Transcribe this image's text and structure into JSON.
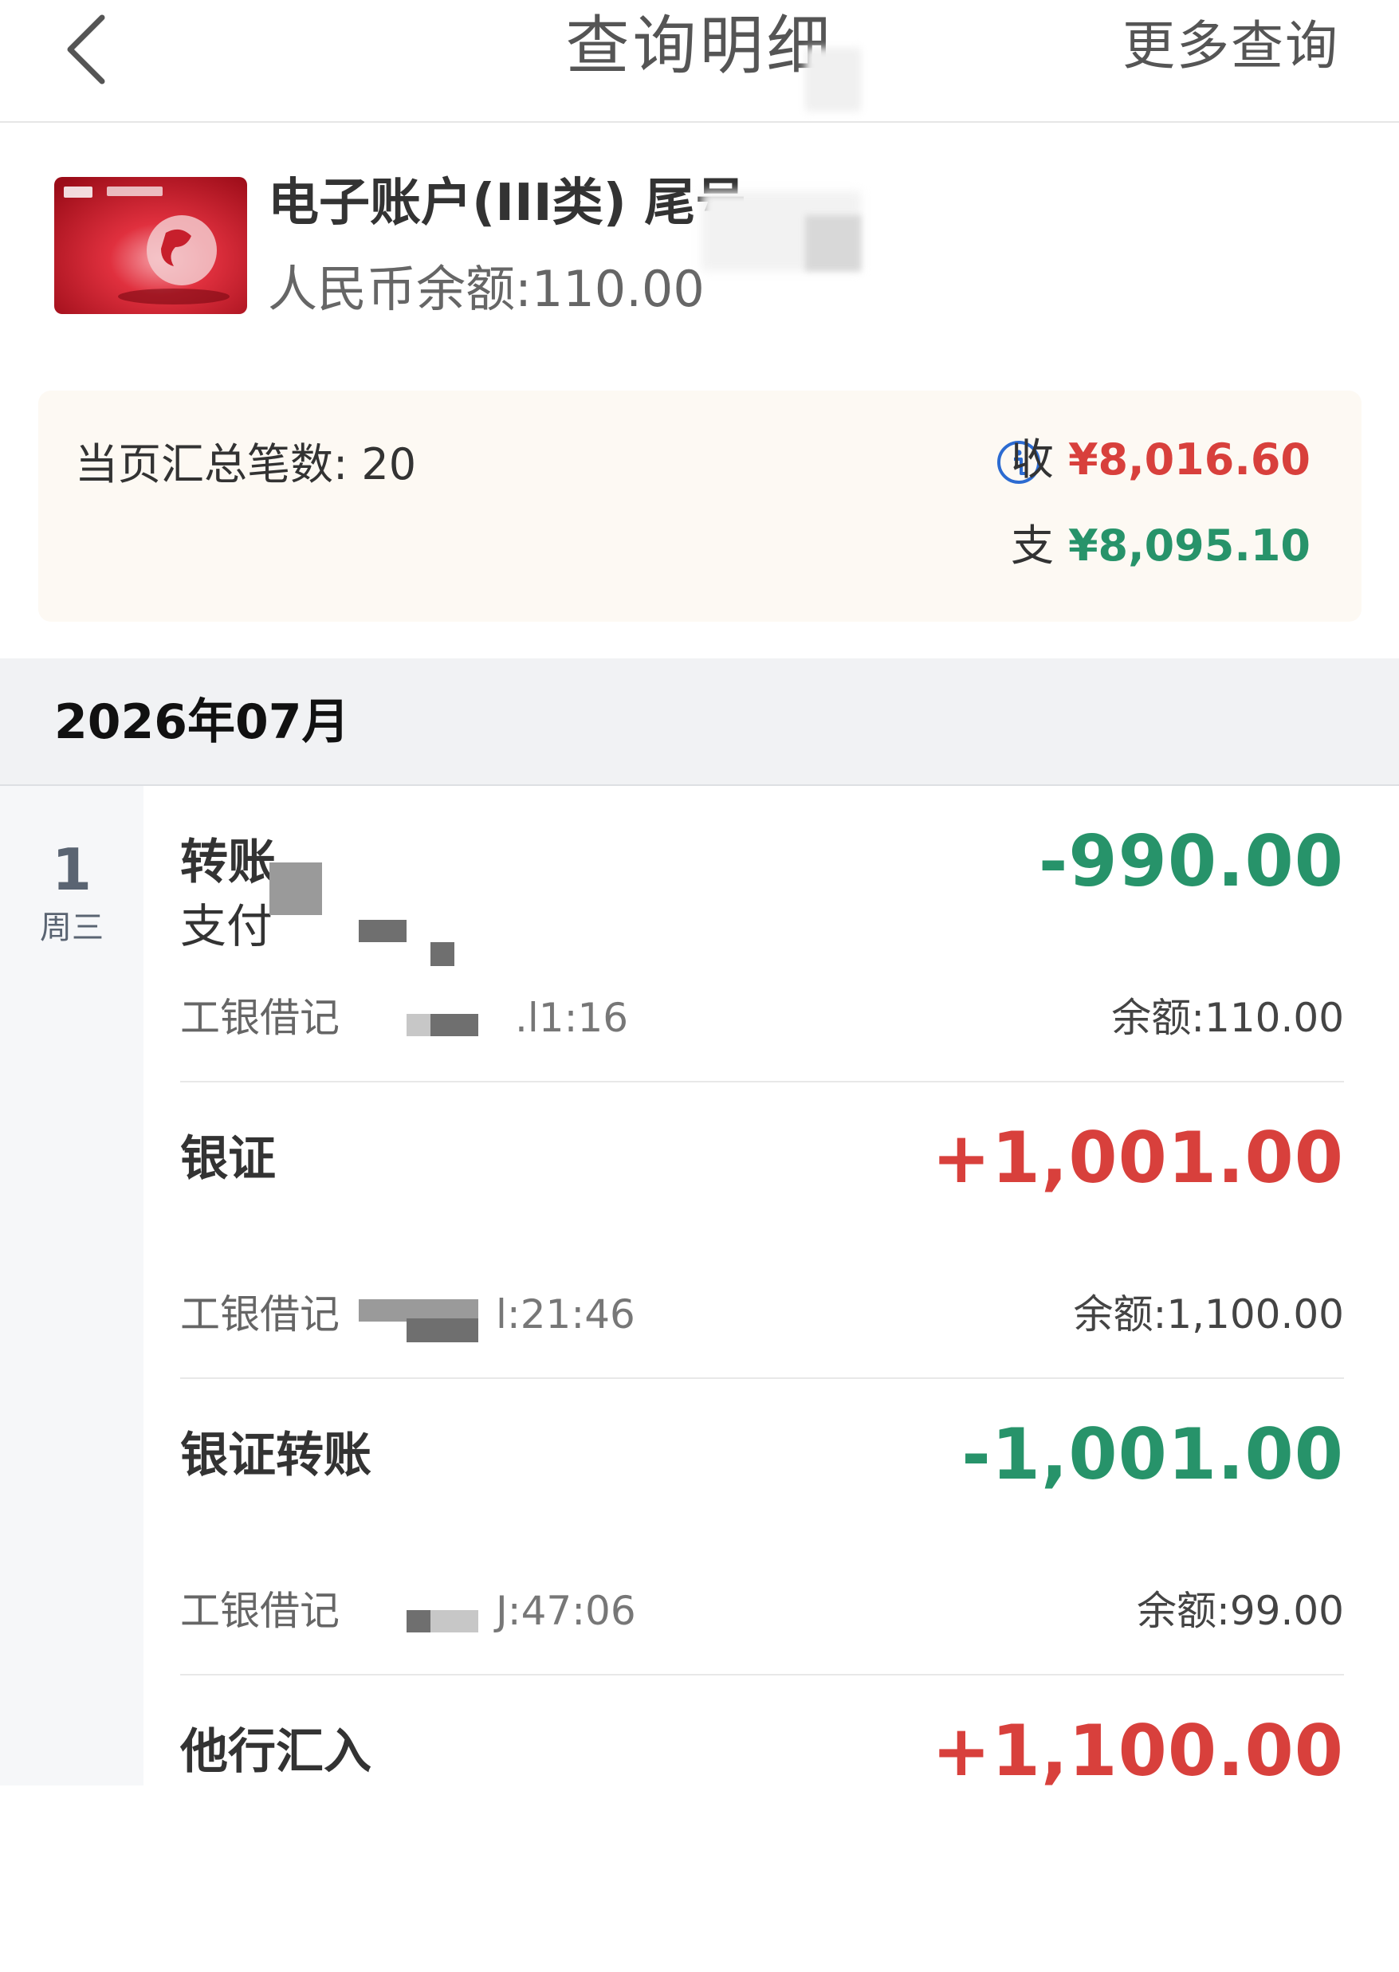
{
  "header": {
    "title": "查询明细",
    "more_query": "更多查询"
  },
  "account": {
    "name": "电子账户(III类) 尾号",
    "balance": "人民币余额:110.00"
  },
  "summary": {
    "count": "当页汇总笔数: 20",
    "income_label": "收",
    "income_amount": "¥8,016.60",
    "expense_label": "支",
    "expense_amount": "¥8,095.10"
  },
  "month": "2026年07月",
  "day": {
    "number": "1",
    "weekday": "周三"
  },
  "transactions": [
    {
      "type": "转账",
      "sub": "支付",
      "amount": "-990.00",
      "direction": "out",
      "card": "工银借记",
      "time": ".l1:16",
      "balance": "余额:110.00"
    },
    {
      "type": "银证",
      "sub": "",
      "amount": "+1,001.00",
      "direction": "in",
      "card": "工银借记",
      "time": "l:21:46",
      "balance": "余额:1,100.00"
    },
    {
      "type": "银证转账",
      "sub": "",
      "amount": "-1,001.00",
      "direction": "out",
      "card": "工银借记",
      "time": "J:47:06",
      "balance": "余额:99.00"
    },
    {
      "type": "他行汇入",
      "sub": "",
      "amount": "+1,100.00",
      "direction": "in",
      "card": "",
      "time": "",
      "balance": ""
    }
  ],
  "colors": {
    "income": "#d8403c",
    "expense": "#27936a",
    "accent": "#2c6bd1"
  }
}
